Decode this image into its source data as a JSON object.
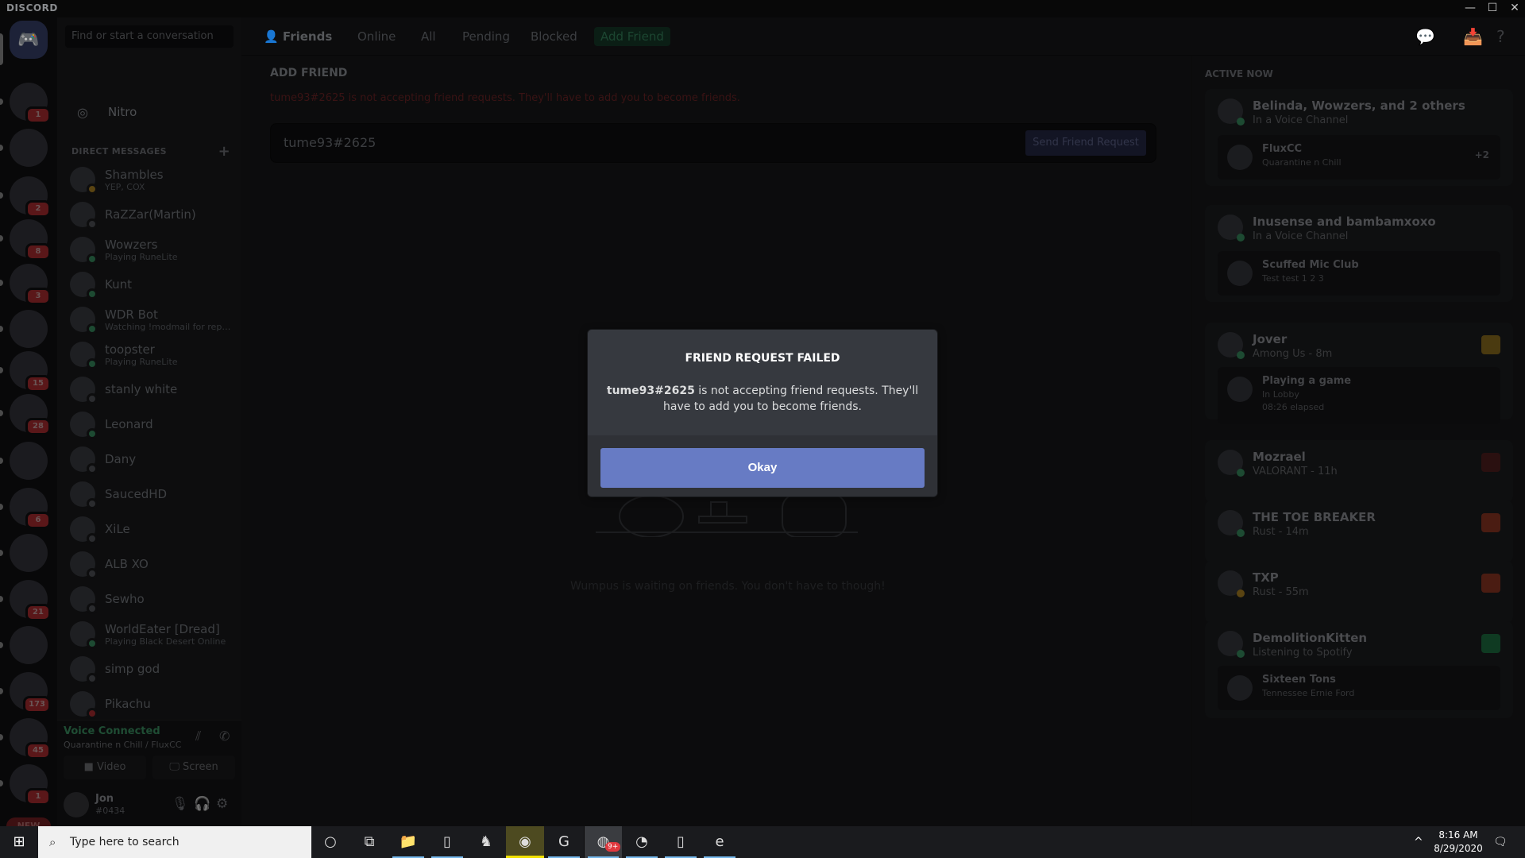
{
  "window": {
    "brand": "DISCORD",
    "controls": {
      "minimize": "—",
      "maximize": "☐",
      "close": "✕"
    }
  },
  "servers": [
    {
      "name": "home",
      "badge": ""
    },
    {
      "name": "spartan-server",
      "badge": "1"
    },
    {
      "name": "wdr-server",
      "badge": ""
    },
    {
      "name": "onepiece-server",
      "badge": "2"
    },
    {
      "name": "server-4",
      "badge": "8"
    },
    {
      "name": "server-5",
      "badge": "3"
    },
    {
      "name": "rs-server",
      "badge": ""
    },
    {
      "name": "rose-server",
      "badge": "15"
    },
    {
      "name": "xmas-server",
      "badge": "28"
    },
    {
      "name": "pikachu-server",
      "badge": ""
    },
    {
      "name": "xile-server",
      "badge": "6"
    },
    {
      "name": "flux-server",
      "badge": ""
    },
    {
      "name": "discord-king-server",
      "badge": "21"
    },
    {
      "name": "pixel-server",
      "badge": ""
    },
    {
      "name": "crown-server",
      "badge": "173"
    },
    {
      "name": "car-server",
      "badge": "45"
    },
    {
      "name": "dragon-server",
      "badge": "1"
    }
  ],
  "new_badge": "NEW",
  "sidebar": {
    "search_placeholder": "Find or start a conversation",
    "nav": [
      {
        "label": "Friends",
        "icon": "friends-icon",
        "active": true
      },
      {
        "label": "Nitro",
        "icon": "nitro-icon",
        "active": false
      }
    ],
    "dm_header": "DIRECT MESSAGES",
    "dm_add": "+",
    "dms": [
      {
        "name": "Shambles",
        "sub": "YEP, COX",
        "status": "idle"
      },
      {
        "name": "RaZZar(Martin)",
        "sub": "",
        "status": "offline"
      },
      {
        "name": "Wowzers",
        "sub": "Playing RuneLite",
        "status": "online"
      },
      {
        "name": "Kunt",
        "sub": "",
        "status": "online"
      },
      {
        "name": "WDR Bot",
        "sub": "Watching !modmail for repor...",
        "status": "online"
      },
      {
        "name": "toopster",
        "sub": "Playing RuneLite",
        "status": "online"
      },
      {
        "name": "stanly white",
        "sub": "",
        "status": "offline"
      },
      {
        "name": "Leonard",
        "sub": "",
        "status": "mobile"
      },
      {
        "name": "Dany",
        "sub": "",
        "status": "offline"
      },
      {
        "name": "SaucedHD",
        "sub": "",
        "status": "offline"
      },
      {
        "name": "XiLe",
        "sub": "",
        "status": "offline"
      },
      {
        "name": "ALB XO",
        "sub": "",
        "status": "offline"
      },
      {
        "name": "Sewho",
        "sub": "",
        "status": "offline"
      },
      {
        "name": "WorldEater [Dread]",
        "sub": "Playing Black Desert Online",
        "status": "online"
      },
      {
        "name": "simp god",
        "sub": "",
        "status": "offline"
      },
      {
        "name": "Pikachu",
        "sub": "",
        "status": "dnd"
      }
    ],
    "voice": {
      "status": "Voice Connected",
      "channel": "Quarantine n Chill / FluxCC",
      "video_label": "Video",
      "screen_label": "Screen"
    },
    "user": {
      "name": "Jon",
      "tag": "#0434"
    }
  },
  "header": {
    "title": "Friends",
    "tabs": [
      "Online",
      "All",
      "Pending",
      "Blocked"
    ],
    "add_friend": "Add Friend"
  },
  "add_friend": {
    "title": "ADD FRIEND",
    "error": "tume93#2625 is not accepting friend requests. They'll have to add you to become friends.",
    "input_value": "tume93#2625",
    "send_label": "Send Friend Request",
    "wumpus_text": "Wumpus is waiting on friends. You don't have to though!"
  },
  "active_now": {
    "title": "ACTIVE NOW",
    "cards": [
      {
        "title": "Belinda, Wowzers, and 2 others",
        "sub": "In a Voice Channel",
        "inner_title": "FluxCC",
        "inner_sub": "Quarantine n Chill",
        "extra": "+2"
      },
      {
        "title": "Inusense and bambamxoxo",
        "sub": "In a Voice Channel",
        "inner_title": "Scuffed Mic Club",
        "inner_sub": "Test test 1 2 3"
      },
      {
        "title": "Jover",
        "sub": "Among Us - 8m",
        "inner_title": "Playing a game",
        "inner_sub": "In Lobby",
        "inner_sub2": "08:26 elapsed"
      },
      {
        "title": "Mozrael",
        "sub": "VALORANT - 11h"
      },
      {
        "title": "THE TOE BREAKER",
        "sub": "Rust - 14m"
      },
      {
        "title": "TXP",
        "sub": "Rust - 55m"
      },
      {
        "title": "DemolitionKitten",
        "sub": "Listening to Spotify",
        "inner_title": "Sixteen Tons",
        "inner_sub": "Tennessee Ernie Ford"
      }
    ]
  },
  "modal": {
    "title": "FRIEND REQUEST FAILED",
    "username": "tume93#2625",
    "message": " is not accepting friend requests. They'll have to add you to become friends.",
    "button": "Okay"
  },
  "taskbar": {
    "search_placeholder": "Type here to search",
    "time": "8:16 AM",
    "date": "8/29/2020",
    "apps": [
      "cortana",
      "task-view",
      "file-explorer",
      "notepad",
      "game",
      "steam",
      "logitech",
      "discord",
      "chrome",
      "file",
      "edge"
    ],
    "discord_badge": "9+"
  },
  "colors": {
    "blurple": "#677bc4",
    "modal_bg": "#36393f",
    "modal_footer": "#2f3136",
    "online": "#1f4d34",
    "error": "#3a1314"
  }
}
